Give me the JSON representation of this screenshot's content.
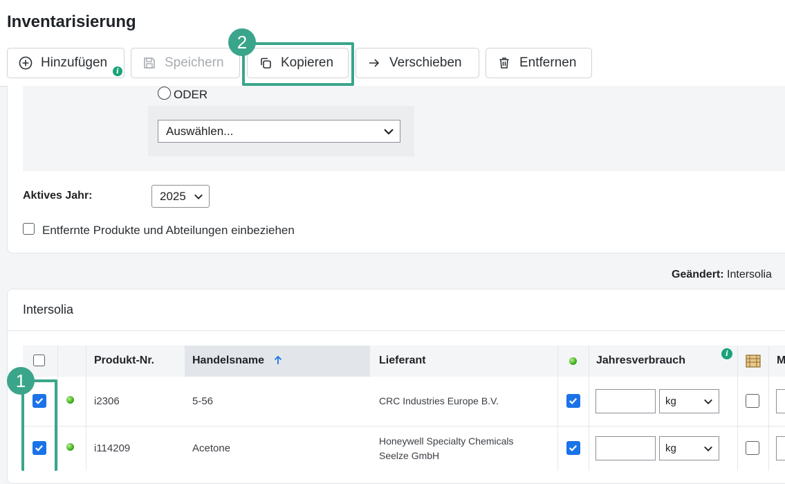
{
  "page": {
    "title": "Inventarisierung"
  },
  "toolbar": {
    "add_label": "Hinzufügen",
    "save_label": "Speichern",
    "copy_label": "Kopieren",
    "move_label": "Verschieben",
    "remove_label": "Entfernen",
    "info_glyph": "i"
  },
  "filter": {
    "or_label": "ODER",
    "select_value": "Auswählen...",
    "year_label": "Aktives Jahr:",
    "year_value": "2025",
    "include_removed_label": "Entfernte Produkte und Abteilungen einbeziehen"
  },
  "meta": {
    "changed_label": "Geändert:",
    "changed_value": "Intersolia"
  },
  "section": {
    "title": "Intersolia"
  },
  "table": {
    "headers": {
      "product_no": "Produkt-Nr.",
      "trade_name": "Handelsname",
      "supplier": "Lieferant",
      "annual_consumption": "Jahresverbrauch",
      "next_col": "M"
    },
    "sort": {
      "column": "trade_name",
      "direction": "ascending"
    },
    "rows": [
      {
        "selected": true,
        "status": "green",
        "product_no": "i2306",
        "trade_name": "5-56",
        "supplier": "CRC Industries Europe B.V.",
        "supplier_line2": "",
        "active": true,
        "consumption": "",
        "unit": "kg",
        "flag": false
      },
      {
        "selected": true,
        "status": "green",
        "product_no": "i114209",
        "trade_name": "Acetone",
        "supplier": "Honeywell Specialty Chemicals",
        "supplier_line2": "Seelze GmbH",
        "active": true,
        "consumption": "",
        "unit": "kg",
        "flag": false
      }
    ]
  },
  "annotations": {
    "step1": "1",
    "step2": "2"
  },
  "colors": {
    "accent": "#3aa58a",
    "checkbox": "#1a73e8",
    "info": "#1aa37a"
  }
}
